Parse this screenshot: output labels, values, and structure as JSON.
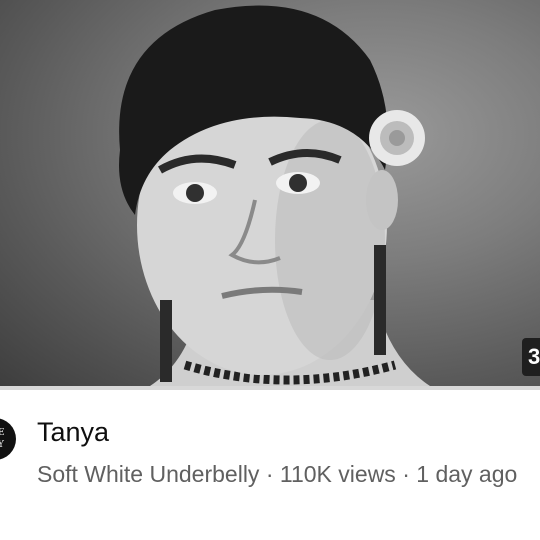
{
  "video": {
    "title": "Tanya",
    "channel": "Soft White Underbelly",
    "views": "110K views",
    "age": "1 day ago",
    "separator": " · ",
    "duration_partial": "3"
  },
  "avatar": {
    "line1": "E",
    "line2": "Y"
  },
  "colors": {
    "meta_text": "#606060",
    "title_text": "#0f0f0f",
    "duration_bg": "#1f1f1f"
  }
}
